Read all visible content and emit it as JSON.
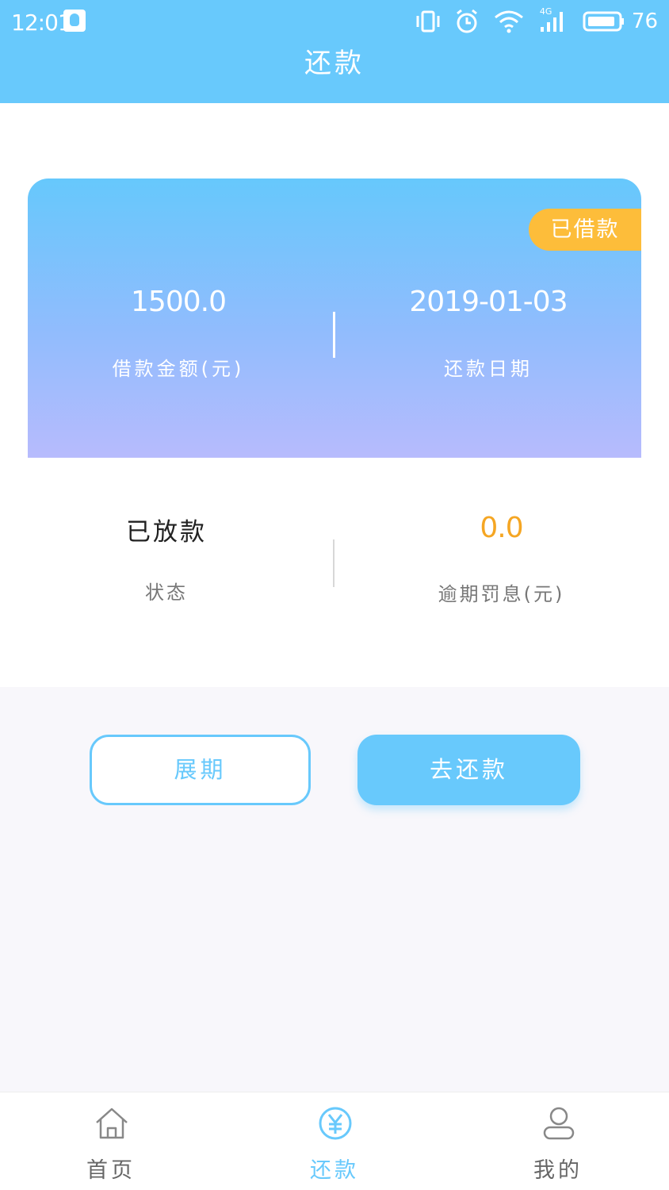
{
  "status_bar": {
    "time": "12:01",
    "network": "4G",
    "battery": "76"
  },
  "header": {
    "title": "还款"
  },
  "loan_card": {
    "badge": "已借款",
    "amount_value": "1500.0",
    "amount_label": "借款金额(元)",
    "date_value": "2019-01-03",
    "date_label": "还款日期"
  },
  "info": {
    "status_value": "已放款",
    "status_label": "状态",
    "penalty_value": "0.0",
    "penalty_label": "逾期罚息(元)"
  },
  "actions": {
    "extend_label": "展期",
    "repay_label": "去还款"
  },
  "tabbar": {
    "items": [
      {
        "label": "首页",
        "icon": "home-icon"
      },
      {
        "label": "还款",
        "icon": "yuan-circle-icon",
        "active": true
      },
      {
        "label": "我的",
        "icon": "user-icon"
      }
    ]
  },
  "colors": {
    "primary": "#68c9fc",
    "badge": "#fdbd3a",
    "penalty": "#f5a623",
    "gradient_end": "#b7bbfd"
  }
}
